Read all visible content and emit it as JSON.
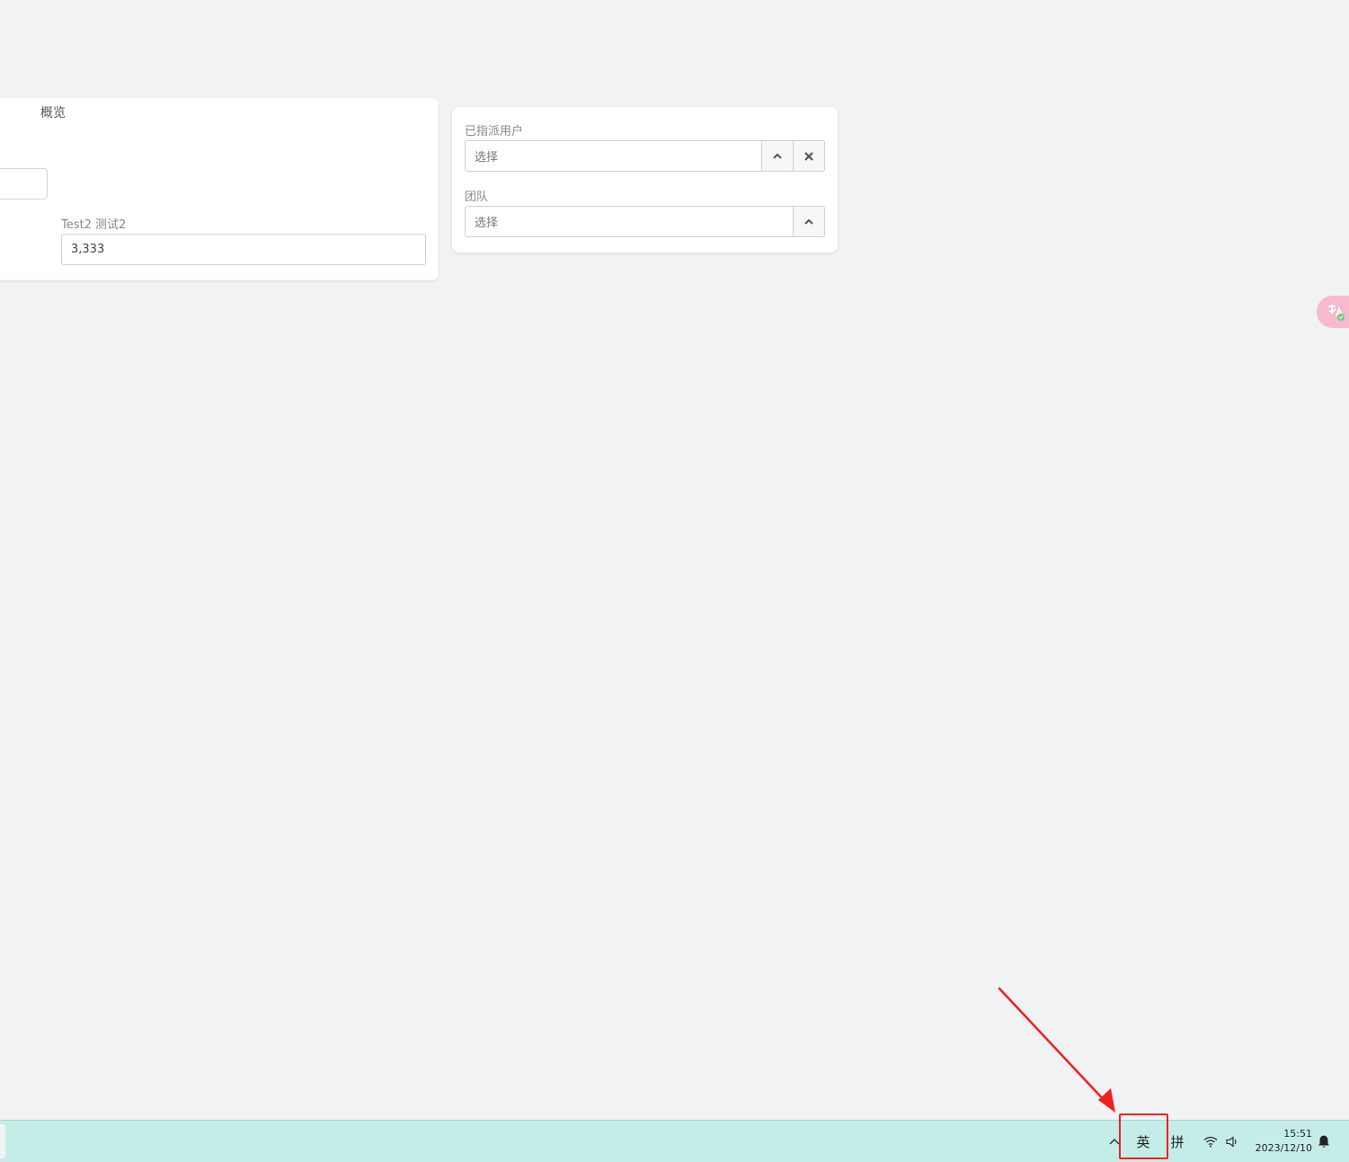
{
  "overview_tab": {
    "label": "概览"
  },
  "fields": {
    "test2_label": "Test2 测试2",
    "test2_value": "3,333",
    "assigned_user_label": "已指派用户",
    "assigned_user_placeholder": "选择",
    "team_label": "团队",
    "team_placeholder": "选择"
  },
  "taskbar": {
    "ime_mode": "英",
    "ime_name": "拼",
    "time": "15:51",
    "date": "2023/12/10",
    "background_color": "#c4ede8"
  },
  "annotation": {
    "color": "#f0201c"
  }
}
